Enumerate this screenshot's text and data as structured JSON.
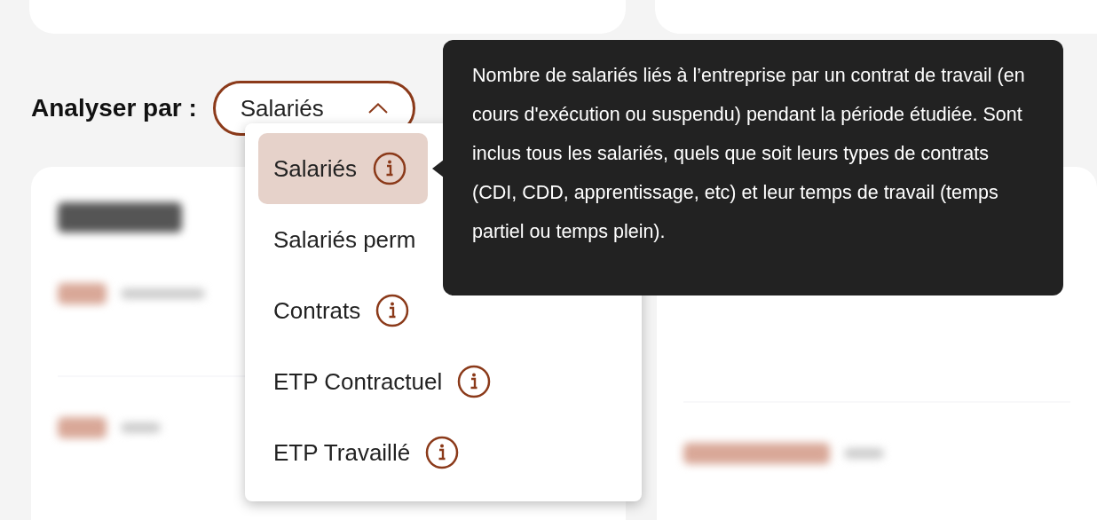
{
  "filter": {
    "label": "Analyser par :",
    "value": "Salariés",
    "expanded": true
  },
  "options": [
    {
      "label": "Salariés",
      "selected": true,
      "has_info": true
    },
    {
      "label": "Salariés perm",
      "selected": false,
      "has_info": false
    },
    {
      "label": "Contrats",
      "selected": false,
      "has_info": true
    },
    {
      "label": "ETP Contractuel",
      "selected": false,
      "has_info": true
    },
    {
      "label": "ETP Travaillé",
      "selected": false,
      "has_info": true
    }
  ],
  "tooltip": {
    "text": "Nombre de salariés liés à l’entreprise par un contrat de travail (en cours d'exécution ou suspendu) pendant la période étudiée. Sont inclus tous les salariés, quels que soit leurs types de contrats (CDI, CDD, apprentissage, etc) et leur temps de travail (temps partiel ou temps plein)."
  }
}
